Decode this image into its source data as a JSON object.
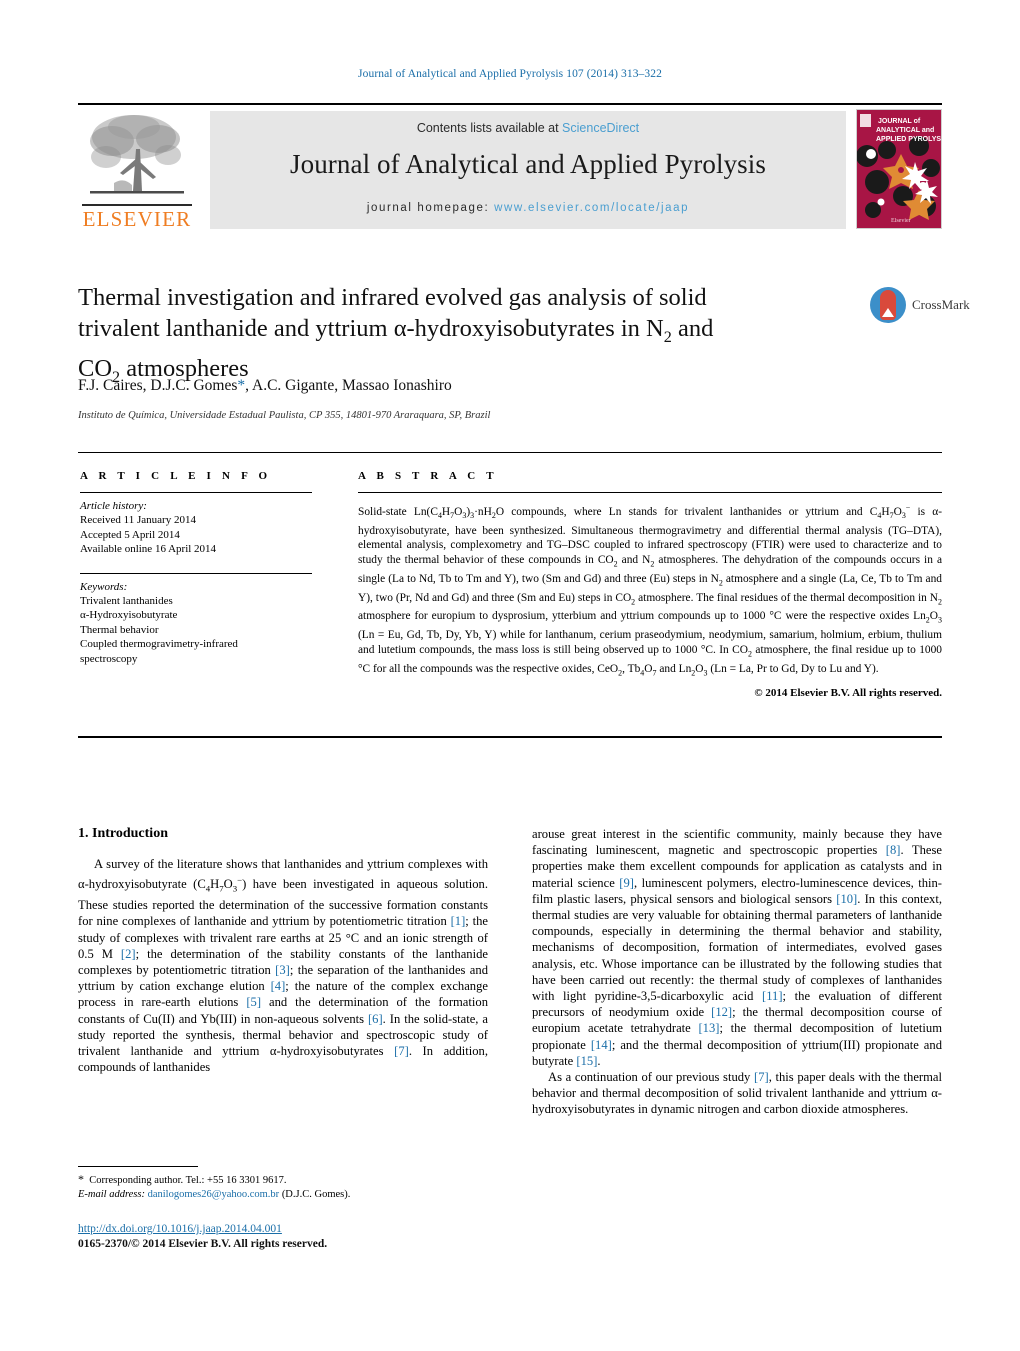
{
  "running_head": "Journal of Analytical and Applied Pyrolysis 107 (2014) 313–322",
  "masthead": {
    "publisher_name": "ELSEVIER",
    "contents_prefix": "Contents lists available at ",
    "contents_link": "ScienceDirect",
    "journal_title": "Journal of Analytical and Applied Pyrolysis",
    "homepage_prefix": "journal homepage:",
    "homepage_url": "www.elsevier.com/locate/jaap",
    "cover_line1": "JOURNAL of",
    "cover_line2": "ANALYTICAL and",
    "cover_line3": "APPLIED PYROLYSIS",
    "cover_bg": "#a81545",
    "link_color": "#4a9ed0"
  },
  "article": {
    "title_line1": "Thermal investigation and infrared evolved gas analysis of solid",
    "title_line2_a": "trivalent lanthanide and yttrium α-hydroxyisobutyrates in N",
    "title_line2_sub": "2",
    "title_line2_b": " and",
    "title_line3_a": "CO",
    "title_line3_sub": "2",
    "title_line3_b": " atmospheres",
    "authors": "F.J. Caires, D.J.C. Gomes",
    "authors_star": "*",
    "authors_rest": ", A.C. Gigante, Massao Ionashiro",
    "affiliation": "Instituto de Química, Universidade Estadual Paulista, CP 355, 14801-970 Araraquara, SP, Brazil",
    "crossmark_label": "CrossMark"
  },
  "article_info": {
    "label": "A R T I C L E   I N F O",
    "history_heading": "Article history:",
    "history": [
      "Received 11 January 2014",
      "Accepted 5 April 2014",
      "Available online 16 April 2014"
    ],
    "keywords_heading": "Keywords:",
    "keywords": [
      "Trivalent lanthanides",
      "α-Hydroxyisobutyrate",
      "Thermal behavior",
      "Coupled thermogravimetry-infrared",
      "spectroscopy"
    ]
  },
  "abstract": {
    "label": "A B S T R A C T",
    "paragraph_html": "Solid-state Ln(C<sub>4</sub>H<sub>7</sub>O<sub>3</sub>)<sub>3</sub>·nH<sub>2</sub>O compounds, where Ln stands for trivalent lanthanides or yttrium and C<sub>4</sub>H<sub>7</sub>O<sub>3</sub><sup>−</sup> is α-hydroxyisobutyrate, have been synthesized. Simultaneous thermogravimetry and differential thermal analysis (TG–DTA), elemental analysis, complexometry and TG–DSC coupled to infrared spectroscopy (FTIR) were used to characterize and to study the thermal behavior of these compounds in CO<sub>2</sub> and N<sub>2</sub> atmospheres. The dehydration of the compounds occurs in a single (La to Nd, Tb to Tm and Y), two (Sm and Gd) and three (Eu) steps in N<sub>2</sub> atmosphere and a single (La, Ce, Tb to Tm and Y), two (Pr, Nd and Gd) and three (Sm and Eu) steps in CO<sub>2</sub> atmosphere. The final residues of the thermal decomposition in N<sub>2</sub> atmosphere for europium to dysprosium, ytterbium and yttrium compounds up to 1000 °C were the respective oxides Ln<sub>2</sub>O<sub>3</sub> (Ln = Eu, Gd, Tb, Dy, Yb, Y) while for lanthanum, cerium praseodymium, neodymium, samarium, holmium, erbium, thulium and lutetium compounds, the mass loss is still being observed up to 1000 °C. In CO<sub>2</sub> atmosphere, the final residue up to 1000 °C for all the compounds was the respective oxides, CeO<sub>2</sub>, Tb<sub>4</sub>O<sub>7</sub> and Ln<sub>2</sub>O<sub>3</sub> (Ln = La, Pr to Gd, Dy to Lu and Y).",
    "copyright": "© 2014 Elsevier B.V. All rights reserved."
  },
  "introduction": {
    "heading": "1.  Introduction",
    "left_paragraph_html": "A survey of the literature shows that lanthanides and yttrium complexes with α-hydroxyisobutyrate (C<sub>4</sub>H<sub>7</sub>O<sub>3</sub><sup>−</sup>) have been investigated in aqueous solution. These studies reported the determination of the successive formation constants for nine complexes of lanthanide and yttrium by potentiometric titration <span class=\"ref\">[1]</span>; the study of complexes with trivalent rare earths at 25 °C and an ionic strength of 0.5 M <span class=\"ref\">[2]</span>; the determination of the stability constants of the lanthanide complexes by potentiometric titration <span class=\"ref\">[3]</span>; the separation of the lanthanides and yttrium by cation exchange elution <span class=\"ref\">[4]</span>; the nature of the complex exchange process in rare-earth elutions <span class=\"ref\">[5]</span> and the determination of the formation constants of Cu(II) and Yb(III) in non-aqueous solvents <span class=\"ref\">[6]</span>. In the solid-state, a study reported the synthesis, thermal behavior and spectroscopic study of trivalent lanthanide and yttrium α-hydroxyisobutyrates <span class=\"ref\">[7]</span>. In addition, compounds of lanthanides",
    "right_paragraph_html": "arouse great interest in the scientific community, mainly because they have fascinating luminescent, magnetic and spectroscopic properties <span class=\"ref\">[8]</span>. These properties make them excellent compounds for application as catalysts and in material science <span class=\"ref\">[9]</span>, luminescent polymers, electro-luminescence devices, thin-film plastic lasers, physical sensors and biological sensors <span class=\"ref\">[10]</span>. In this context, thermal studies are very valuable for obtaining thermal parameters of lanthanide compounds, especially in determining the thermal behavior and stability, mechanisms of decomposition, formation of intermediates, evolved gases analysis, etc. Whose importance can be illustrated by the following studies that have been carried out recently: the thermal study of complexes of lanthanides with light pyridine-3,5-dicarboxylic acid <span class=\"ref\">[11]</span>; the evaluation of different precursors of neodymium oxide <span class=\"ref\">[12]</span>; the thermal decomposition course of europium acetate tetrahydrate <span class=\"ref\">[13]</span>; the thermal decomposition of lutetium propionate <span class=\"ref\">[14]</span>; and the thermal decomposition of yttrium(III) propionate and butyrate <span class=\"ref\">[15]</span>.",
    "right_paragraph2_html": "As a continuation of our previous study <span class=\"ref\">[7]</span>, this paper deals with the thermal behavior and thermal decomposition of solid trivalent lanthanide and yttrium α-hydroxyisobutyrates in dynamic nitrogen and carbon dioxide atmospheres."
  },
  "footer": {
    "corresponding_html": "<span style=\"font-size:12px\">*</span>&nbsp; Corresponding author. Tel.: +55 16 3301 9617.",
    "email_label": "E-mail address:",
    "email": "danilogomes26@yahoo.com.br",
    "email_suffix": " (D.J.C. Gomes).",
    "doi_url": "http://dx.doi.org/10.1016/j.jaap.2014.04.001",
    "issn_line": "0165-2370/© 2014 Elsevier B.V. All rights reserved."
  }
}
